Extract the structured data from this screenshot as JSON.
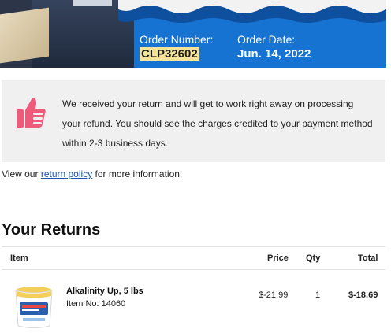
{
  "header": {
    "order_number_label": "Order Number:",
    "order_number": "CLP32602",
    "order_date_label": "Order Date:",
    "order_date": "Jun. 14, 2022"
  },
  "notice": {
    "icon": "thumbs-up-icon",
    "text": "We received your return and will get to work right away on processing your refund. You should see the charges credited to your payment method within 2-3 business days."
  },
  "policy": {
    "prefix": "View our",
    "link_label": "return policy",
    "suffix": "for more information."
  },
  "returns": {
    "title": "Your Returns",
    "columns": [
      "Item",
      "Price",
      "Qty",
      "Total"
    ],
    "items": [
      {
        "name": "Alkalinity Up, 5 lbs",
        "item_no": "Item No: 14060",
        "price": "$-21.99",
        "qty": "1",
        "total": "$-18.69"
      }
    ]
  },
  "colors": {
    "header_blue": "#1673d2",
    "highlight": "#f6e39a",
    "thumb_pink": "#ee5a7a",
    "link_blue": "#1a55b0"
  }
}
